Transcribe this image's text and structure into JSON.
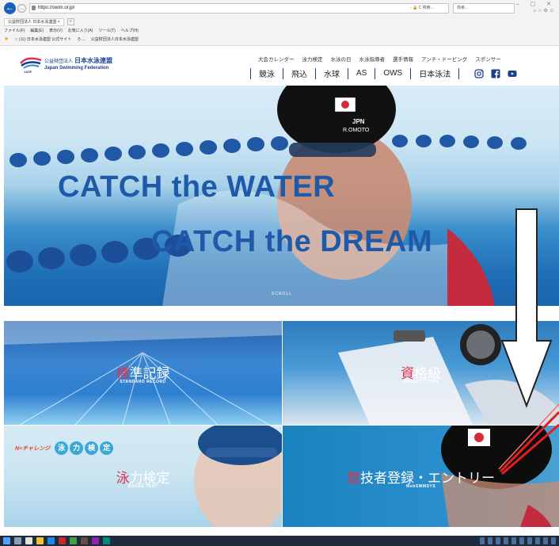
{
  "browser": {
    "url": "https://swim.or.jp/",
    "address_right": "- 🔒 C  検索...",
    "search_placeholder": "検索...",
    "tab_label": "公益財団法人 日本水泳連盟",
    "tab_close": "×",
    "menu": [
      "ファイル(F)",
      "編集(E)",
      "表示(V)",
      "お気に入り(A)",
      "ツール(T)",
      "ヘルプ(H)"
    ],
    "favorites": [
      "☆ (公) 日本水泳連盟 公式サイト",
      "ろ ... ",
      "公益財団法人日本水泳連盟"
    ],
    "window_controls": "–  ▢  ✕"
  },
  "header": {
    "org_prefix": "公益財団法人",
    "org_name": "日本水泳連盟",
    "org_name_en": "Japan Swimming Federation",
    "logo_abbr": "JASF",
    "top_nav": [
      "大会カレンダー",
      "泳力検定",
      "水泳の日",
      "水泳指導者",
      "選手情報",
      "アンチ・ドーピング",
      "スポンサー"
    ],
    "main_nav": [
      "競泳",
      "飛込",
      "水球",
      "AS",
      "OWS",
      "日本泳法"
    ],
    "sns": [
      "instagram-icon",
      "facebook-icon",
      "youtube-icon"
    ]
  },
  "hero": {
    "line1": "CATCH the WATER",
    "line2": "CATCH the DREAM",
    "scroll": "SCROLL"
  },
  "tiles": {
    "standard": {
      "title_hl": "標",
      "title_rest": "準記録",
      "sub": "STANDARD RECORD"
    },
    "qualification": {
      "title_hl": "資",
      "title_rest": "格級",
      "sub": "QUALIFICATION"
    },
    "badge": {
      "brand": "N≡チャレンジ",
      "chars": [
        "泳",
        "力",
        "検",
        "定"
      ],
      "title_hl": "泳",
      "title_rest": "力検定",
      "sub": "BADGE TEST"
    },
    "entry": {
      "title_hl": "競",
      "title_rest": "技者登録・エントリー",
      "sub": "WebSWMSYS"
    }
  },
  "colors": {
    "brand": "#1b3f8f",
    "accent": "#e2324a",
    "hero_text": "#1e5aa8"
  }
}
